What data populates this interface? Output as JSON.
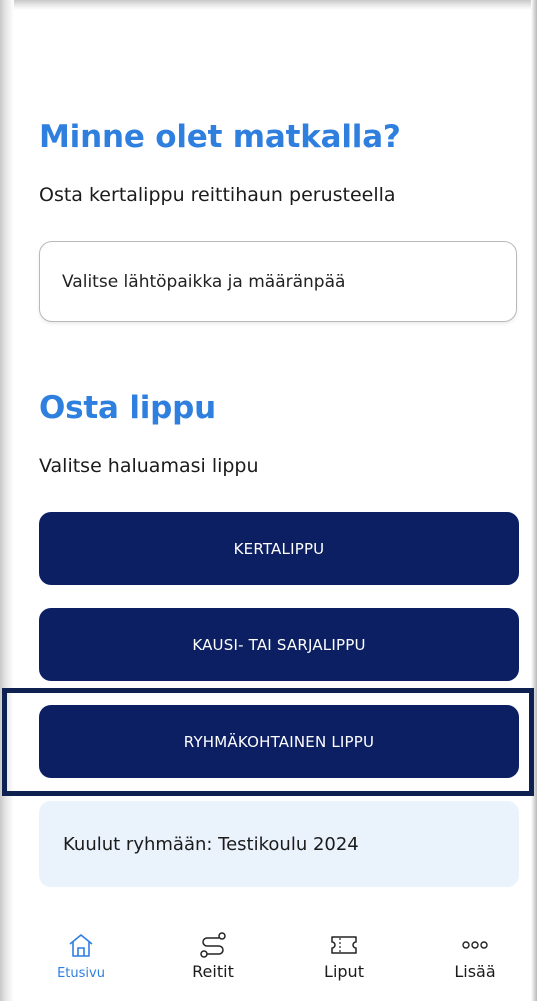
{
  "destination_section": {
    "title": "Minne olet matkalla?",
    "subtitle": "Osta kertalippu reittihaun perusteella",
    "route_field_placeholder": "Valitse lähtöpaikka ja määränpää"
  },
  "ticket_section": {
    "title": "Osta lippu",
    "subtitle": "Valitse haluamasi lippu",
    "buttons": [
      {
        "label": "KERTALIPPU"
      },
      {
        "label": "KAUSI- TAI SARJALIPPU"
      },
      {
        "label": "RYHMÄKOHTAINEN LIPPU"
      }
    ],
    "group_info": "Kuulut ryhmään: Testikoulu 2024"
  },
  "bottom_nav": {
    "items": [
      {
        "label": "Etusivu",
        "icon": "home-icon",
        "active": true
      },
      {
        "label": "Reitit",
        "icon": "route-icon",
        "active": false
      },
      {
        "label": "Liput",
        "icon": "ticket-icon",
        "active": false
      },
      {
        "label": "Lisää",
        "icon": "more-icon",
        "active": false
      }
    ]
  },
  "colors": {
    "accent": "#2f7fdf",
    "button_bg": "#0c1f62",
    "highlight_border": "#0f2151",
    "info_bg": "#eaf2fc"
  }
}
